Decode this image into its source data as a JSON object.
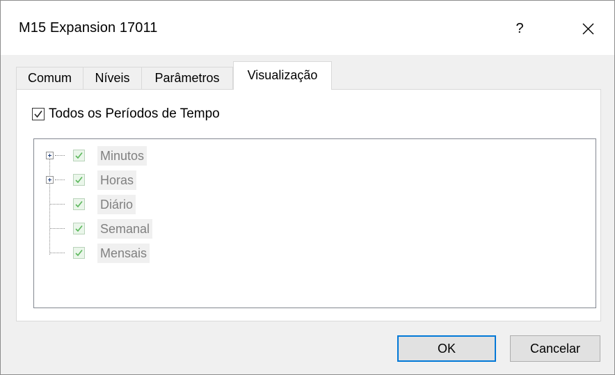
{
  "window": {
    "title": "M15 Expansion 17011",
    "help_label": "?",
    "close_icon": "close-icon"
  },
  "tabs": [
    {
      "label": "Comum",
      "active": false
    },
    {
      "label": "Níveis",
      "active": false
    },
    {
      "label": "Parâmetros",
      "active": false
    },
    {
      "label": "Visualização",
      "active": true
    }
  ],
  "visualization": {
    "all_periods_label": "Todos os Períodos de Tempo",
    "all_periods_checked": true,
    "tree": [
      {
        "label": "Minutos",
        "checked": true,
        "expandable": true
      },
      {
        "label": "Horas",
        "checked": true,
        "expandable": true
      },
      {
        "label": "Diário",
        "checked": true,
        "expandable": false
      },
      {
        "label": "Semanal",
        "checked": true,
        "expandable": false
      },
      {
        "label": "Mensais",
        "checked": true,
        "expandable": false
      }
    ]
  },
  "buttons": {
    "ok_label": "OK",
    "cancel_label": "Cancelar"
  },
  "colors": {
    "accent": "#0078d7",
    "disabled_text": "#808080",
    "check_green": "#5cb85c"
  }
}
